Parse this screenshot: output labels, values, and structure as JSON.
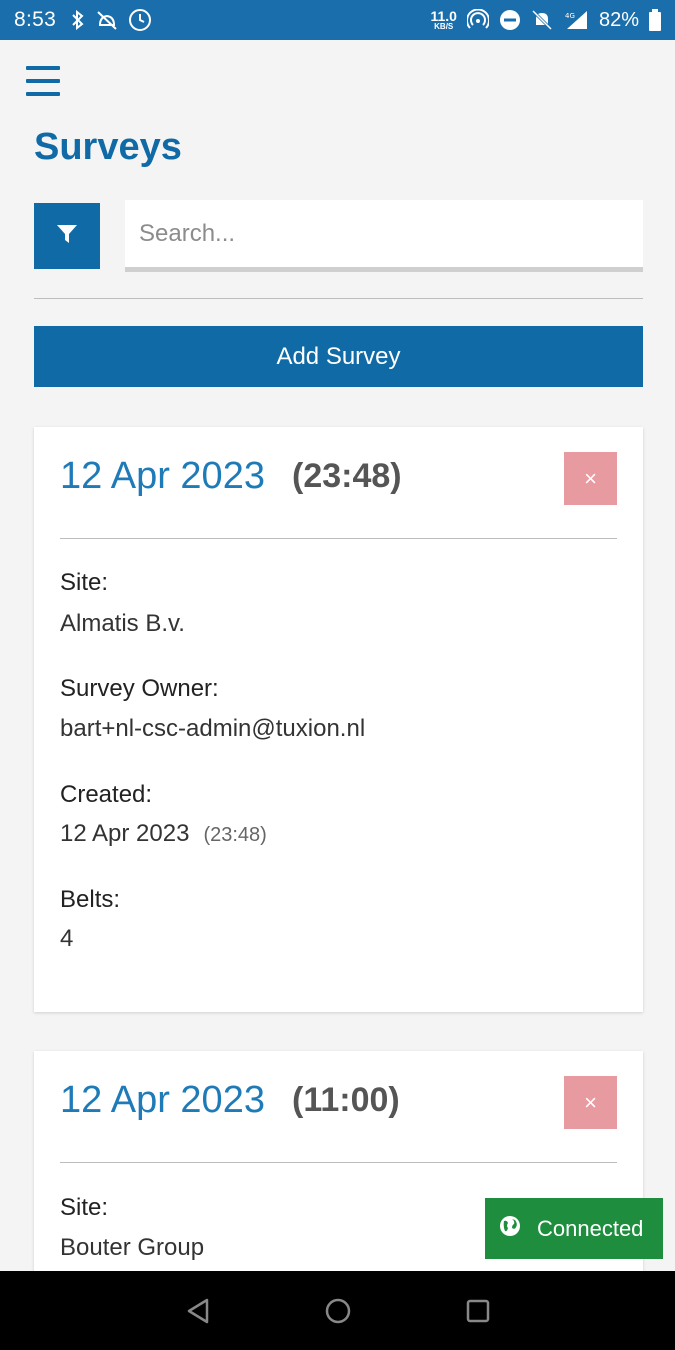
{
  "status_bar": {
    "time": "8:53",
    "net_speed_value": "11.0",
    "net_speed_unit": "KB/S",
    "battery_percent": "82%"
  },
  "header": {
    "title": "Surveys"
  },
  "search": {
    "placeholder": "Search..."
  },
  "actions": {
    "add_survey_label": "Add Survey",
    "delete_label": "×"
  },
  "surveys": [
    {
      "date": "12 Apr 2023",
      "time": "(23:48)",
      "site_label": "Site:",
      "site": "Almatis B.v.",
      "owner_label": "Survey Owner:",
      "owner": "bart+nl-csc-admin@tuxion.nl",
      "created_label": "Created:",
      "created_date": "12 Apr 2023",
      "created_time": "(23:48)",
      "belts_label": "Belts:",
      "belts": "4"
    },
    {
      "date": "12 Apr 2023",
      "time": "(11:00)",
      "site_label": "Site:",
      "site": "Bouter Group"
    }
  ],
  "toast": {
    "label": "Connected"
  },
  "colors": {
    "primary": "#0f6aa6",
    "status_bar": "#1a6eac",
    "date_text": "#1f7bb8",
    "delete": "#e79a9f",
    "connected": "#1e8e3e"
  },
  "icons": {
    "filter": "filter-icon",
    "menu": "hamburger-menu-icon",
    "globe": "globe-icon",
    "nav_back": "back-triangle-icon",
    "nav_home": "home-circle-icon",
    "nav_recents": "recents-square-icon"
  }
}
